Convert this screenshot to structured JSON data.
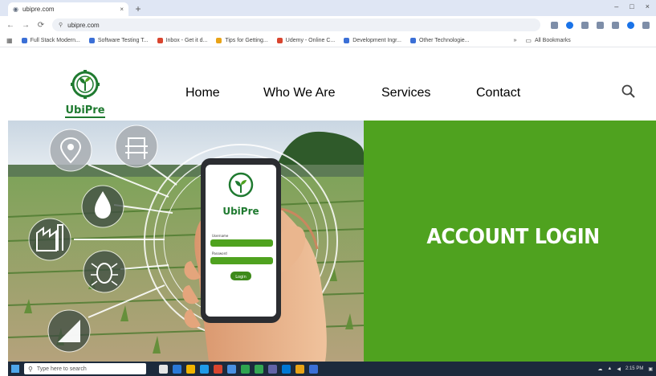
{
  "browser": {
    "tab_title": "ubipre.com",
    "tab_close": "×",
    "new_tab": "+",
    "window_controls": [
      "–",
      "□",
      "×"
    ],
    "url": "ubipre.com",
    "nav": {
      "back": "←",
      "forward": "→",
      "reload": "⟳"
    },
    "bookmarks": [
      {
        "label": "Full Stack Modern...",
        "color": "#3b6fd6"
      },
      {
        "label": "Software Testing T...",
        "color": "#3b6fd6"
      },
      {
        "label": "Inbox - Get it d...",
        "color": "#d9452f"
      },
      {
        "label": "Tips for Getting...",
        "color": "#e8a317"
      },
      {
        "label": "Udemy - Online C...",
        "color": "#d9452f"
      },
      {
        "label": "Development Ingr...",
        "color": "#3b6fd6"
      },
      {
        "label": "Other Technologie...",
        "color": "#3b6fd6"
      }
    ],
    "bookmarks_overflow": "»",
    "all_bookmarks": "All Bookmarks"
  },
  "site": {
    "logo_text": "UbiPre",
    "nav": [
      "Home",
      "Who We Are",
      "Services",
      "Contact"
    ],
    "search_icon": "search-icon",
    "brand_green": "#4fa21f",
    "logo_green": "#1f7a30"
  },
  "hero": {
    "phone_logo_text": "UbiPre",
    "phone_field_labels": [
      "Username",
      "Password"
    ],
    "phone_button": "Login",
    "login_title": "ACCOUNT LOGIN",
    "icons": [
      "location-icon",
      "sensor-icon",
      "water-drop-icon",
      "factory-icon",
      "bug-icon",
      "growth-chart-icon"
    ]
  },
  "taskbar": {
    "search_placeholder": "Type here to search",
    "clock": "2:15 PM"
  }
}
